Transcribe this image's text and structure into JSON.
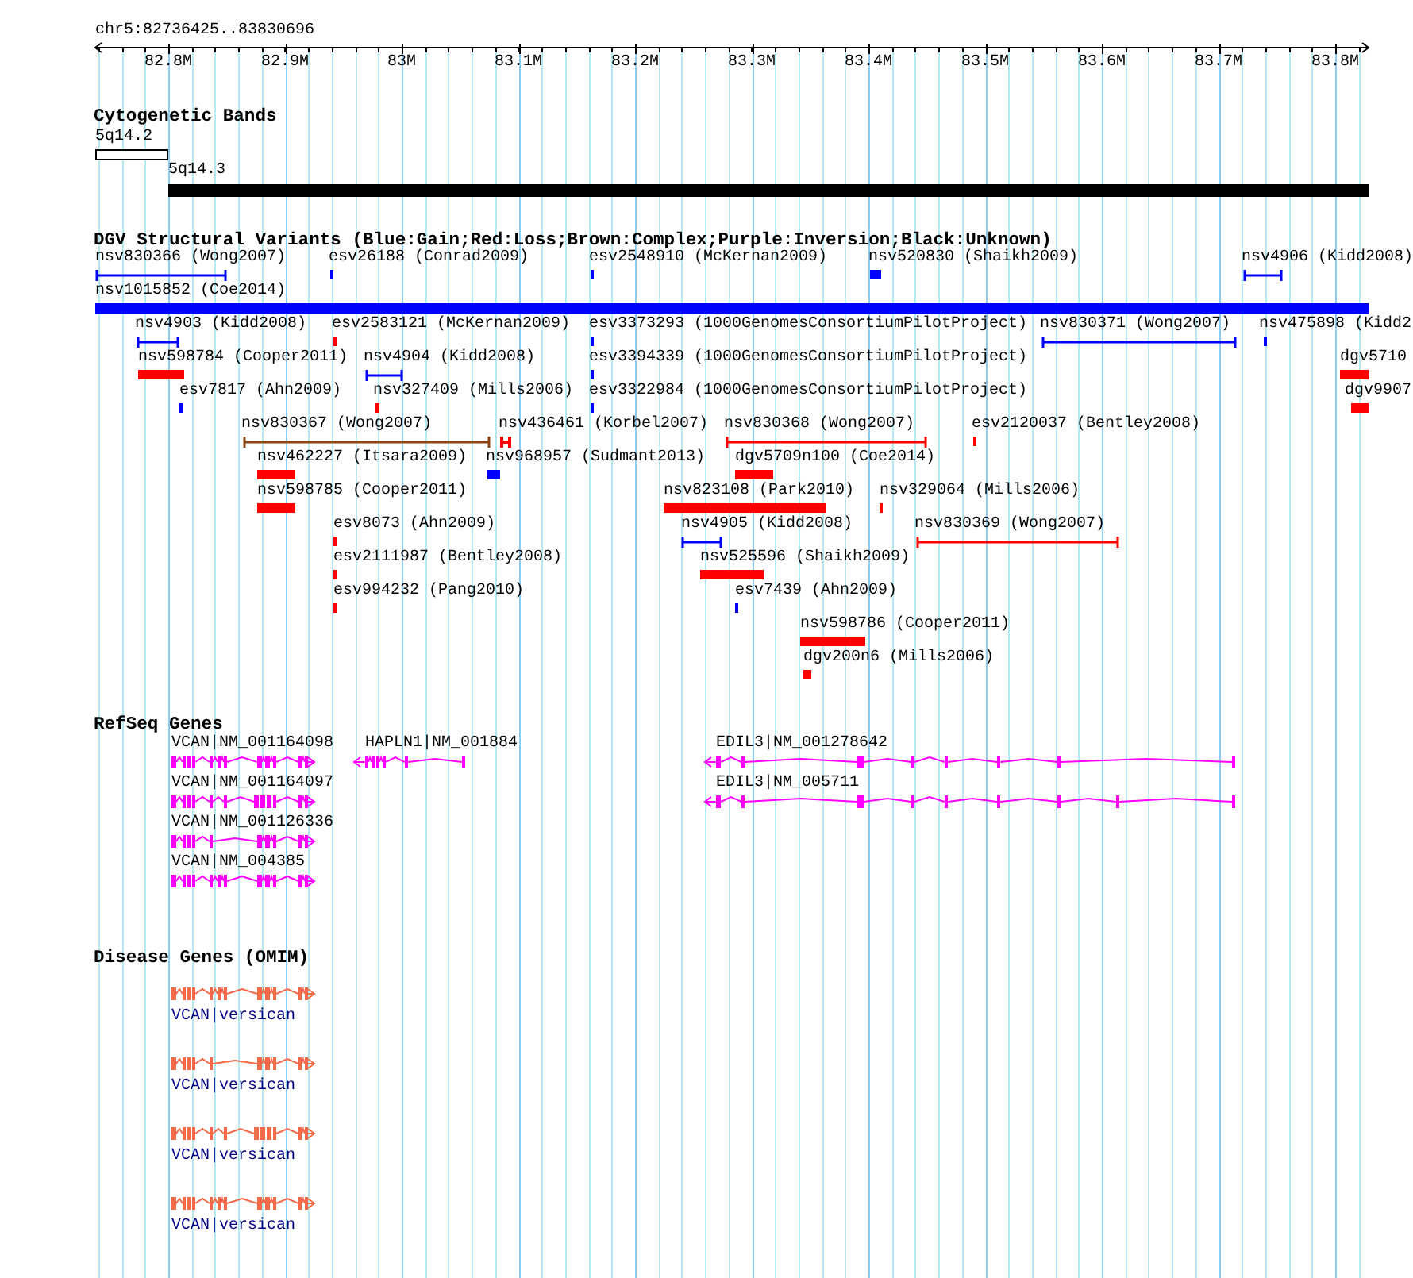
{
  "ruler": {
    "location": "chr5:82736425..83830696",
    "ticks": [
      "82.8M",
      "82.9M",
      "83M",
      "83.1M",
      "83.2M",
      "83.3M",
      "83.4M",
      "83.5M",
      "83.6M",
      "83.7M",
      "83.8M"
    ]
  },
  "tracks": [
    {
      "kind": "cytobands",
      "title": "Cytogenetic Bands",
      "bands": [
        {
          "name": "5q14.2",
          "color": "#ffffff"
        },
        {
          "name": "5q14.3",
          "color": "#000000"
        }
      ]
    },
    {
      "kind": "variants",
      "title": "DGV Structural Variants (Blue:Gain;Red:Loss;Brown:Complex;Purple:Inversion;Black:Unknown)",
      "rows": [
        {
          "features": [
            {
              "label": "nsv830366 (Wong2007)",
              "kind": "span",
              "color": "#0000ff"
            },
            {
              "label": "esv26188 (Conrad2009)",
              "kind": "block",
              "color": "#0000ff"
            },
            {
              "label": "esv2548910 (McKernan2009)",
              "kind": "block",
              "color": "#0000ff"
            },
            {
              "label": "nsv520830 (Shaikh2009)",
              "kind": "block",
              "color": "#0000ff"
            },
            {
              "label": "nsv4906 (Kidd2008)",
              "kind": "span",
              "color": "#0000ff"
            }
          ]
        },
        {
          "features": [
            {
              "label": "nsv1015852 (Coe2014)",
              "kind": "block",
              "color": "#0000ff"
            }
          ]
        },
        {
          "features": [
            {
              "label": "nsv4903 (Kidd2008)",
              "kind": "span",
              "color": "#0000ff"
            },
            {
              "label": "esv2583121 (McKernan2009)",
              "kind": "block",
              "color": "#ff0000"
            },
            {
              "label": "esv3373293 (1000GenomesConsortiumPilotProject)",
              "kind": "block",
              "color": "#0000ff"
            },
            {
              "label": "nsv830371 (Wong2007)",
              "kind": "span",
              "color": "#0000ff"
            },
            {
              "label": "nsv475898 (Kidd2",
              "kind": "block",
              "color": "#0000ff"
            }
          ]
        },
        {
          "features": [
            {
              "label": "nsv598784 (Cooper2011)",
              "kind": "block",
              "color": "#ff0000"
            },
            {
              "label": "nsv4904 (Kidd2008)",
              "kind": "span",
              "color": "#0000ff"
            },
            {
              "label": "esv3394339 (1000GenomesConsortiumPilotProject)",
              "kind": "block",
              "color": "#0000ff"
            },
            {
              "label": "dgv5710",
              "kind": "block",
              "color": "#ff0000"
            }
          ]
        },
        {
          "features": [
            {
              "label": "esv7817 (Ahn2009)",
              "kind": "block",
              "color": "#0000ff"
            },
            {
              "label": "nsv327409 (Mills2006)",
              "kind": "block",
              "color": "#ff0000"
            },
            {
              "label": "esv3322984 (1000GenomesConsortiumPilotProject)",
              "kind": "block",
              "color": "#0000ff"
            },
            {
              "label": "dgv9907",
              "kind": "block",
              "color": "#ff0000"
            }
          ]
        },
        {
          "features": [
            {
              "label": "nsv830367 (Wong2007)",
              "kind": "span",
              "color": "#8b4513"
            },
            {
              "label": "nsv436461 (Korbel2007)",
              "kind": "span",
              "color": "#ff0000"
            },
            {
              "label": "nsv830368 (Wong2007)",
              "kind": "span",
              "color": "#ff0000"
            },
            {
              "label": "esv2120037 (Bentley2008)",
              "kind": "block",
              "color": "#ff0000"
            }
          ]
        },
        {
          "features": [
            {
              "label": "nsv462227 (Itsara2009)",
              "kind": "block",
              "color": "#ff0000"
            },
            {
              "label": "nsv968957 (Sudmant2013)",
              "kind": "block",
              "color": "#0000ff"
            },
            {
              "label": "dgv5709n100 (Coe2014)",
              "kind": "block",
              "color": "#ff0000"
            }
          ]
        },
        {
          "features": [
            {
              "label": "nsv598785 (Cooper2011)",
              "kind": "block",
              "color": "#ff0000"
            },
            {
              "label": "nsv823108 (Park2010)",
              "kind": "block",
              "color": "#ff0000"
            },
            {
              "label": "nsv329064 (Mills2006)",
              "kind": "block",
              "color": "#ff0000"
            }
          ]
        },
        {
          "features": [
            {
              "label": "esv8073 (Ahn2009)",
              "kind": "block",
              "color": "#ff0000"
            },
            {
              "label": "nsv4905 (Kidd2008)",
              "kind": "span",
              "color": "#0000ff"
            },
            {
              "label": "nsv830369 (Wong2007)",
              "kind": "span",
              "color": "#ff0000"
            }
          ]
        },
        {
          "features": [
            {
              "label": "esv2111987 (Bentley2008)",
              "kind": "block",
              "color": "#ff0000"
            },
            {
              "label": "nsv525596 (Shaikh2009)",
              "kind": "block",
              "color": "#ff0000"
            }
          ]
        },
        {
          "features": [
            {
              "label": "esv994232 (Pang2010)",
              "kind": "block",
              "color": "#ff0000"
            },
            {
              "label": "esv7439 (Ahn2009)",
              "kind": "block",
              "color": "#0000ff"
            }
          ]
        },
        {
          "features": [
            {
              "label": "nsv598786 (Cooper2011)",
              "kind": "block",
              "color": "#ff0000"
            }
          ]
        },
        {
          "features": [
            {
              "label": "dgv200n6 (Mills2006)",
              "kind": "block",
              "color": "#ff0000"
            }
          ]
        }
      ]
    },
    {
      "kind": "refseq",
      "title": "RefSeq Genes",
      "rows": [
        {
          "genes": [
            {
              "label": "VCAN|NM_001164098",
              "reverse": false
            },
            {
              "label": "HAPLN1|NM_001884",
              "reverse": true
            },
            {
              "label": "EDIL3|NM_001278642",
              "reverse": true
            }
          ]
        },
        {
          "genes": [
            {
              "label": "VCAN|NM_001164097",
              "reverse": false
            },
            {
              "label": "EDIL3|NM_005711",
              "reverse": true
            }
          ]
        },
        {
          "genes": [
            {
              "label": "VCAN|NM_001126336",
              "reverse": false
            }
          ]
        },
        {
          "genes": [
            {
              "label": "VCAN|NM_004385",
              "reverse": false
            }
          ]
        }
      ]
    },
    {
      "kind": "omim",
      "title": "Disease Genes (OMIM)",
      "genes": [
        {
          "label": "VCAN|versican",
          "reverse": false
        },
        {
          "label": "VCAN|versican",
          "reverse": false
        },
        {
          "label": "VCAN|versican",
          "reverse": false
        },
        {
          "label": "VCAN|versican",
          "reverse": false
        }
      ]
    }
  ]
}
